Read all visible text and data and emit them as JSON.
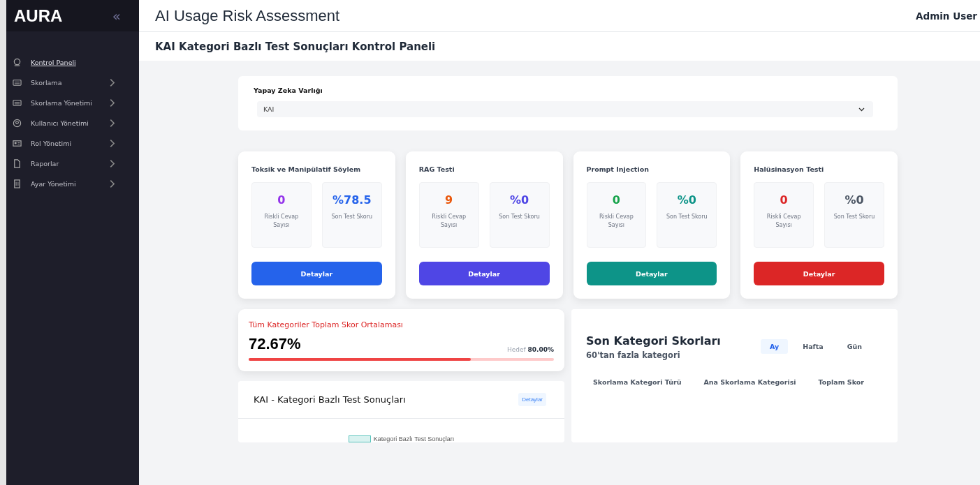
{
  "sidebar": {
    "logo": "AURA",
    "collapse_glyph": "«",
    "items": [
      {
        "label": "Kontrol Paneli",
        "selected": true,
        "has_submenu": false
      },
      {
        "label": "Skorlama",
        "selected": false,
        "has_submenu": true
      },
      {
        "label": "Skorlama Yönetimi",
        "selected": false,
        "has_submenu": true
      },
      {
        "label": "Kullanıcı Yönetimi",
        "selected": false,
        "has_submenu": true
      },
      {
        "label": "Rol Yönetimi",
        "selected": false,
        "has_submenu": true
      },
      {
        "label": "Raporlar",
        "selected": false,
        "has_submenu": true
      },
      {
        "label": "Ayar Yönetimi",
        "selected": false,
        "has_submenu": true
      }
    ]
  },
  "header": {
    "title": "AI Usage Risk Assessment",
    "user": "Admin User"
  },
  "page_title": "KAI Kategori Bazlı Test Sonuçları Kontrol Paneli",
  "entity_select": {
    "label": "Yapay Zeka Varlığı",
    "value": "KAI"
  },
  "test_cards": [
    {
      "title": "Toksik ve Manipülatif Söylem",
      "button": "Detaylar",
      "color": "#2563eb",
      "stats": [
        {
          "value": "0",
          "label": "Riskli Cevap Sayısı",
          "color": "#9333ea"
        },
        {
          "value": "%78.5",
          "label": "Son Test Skoru",
          "color": "#2563eb"
        }
      ]
    },
    {
      "title": "RAG Testi",
      "button": "Detaylar",
      "color": "#4f46e5",
      "stats": [
        {
          "value": "9",
          "label": "Riskli Cevap Sayısı",
          "color": "#ea580c"
        },
        {
          "value": "%0",
          "label": "Son Test Skoru",
          "color": "#4f46e5"
        }
      ]
    },
    {
      "title": "Prompt Injection",
      "button": "Detaylar",
      "color": "#0d9488",
      "stats": [
        {
          "value": "0",
          "label": "Riskli Cevap Sayısı",
          "color": "#16a34a"
        },
        {
          "value": "%0",
          "label": "Son Test Skoru",
          "color": "#0d9488"
        }
      ]
    },
    {
      "title": "Halüsinasyon Testi",
      "button": "Detaylar",
      "color": "#dc2626",
      "stats": [
        {
          "value": "0",
          "label": "Riskli Cevap Sayısı",
          "color": "#dc2626"
        },
        {
          "value": "%0",
          "label": "Son Test Skoru",
          "color": "#4b5563"
        }
      ]
    }
  ],
  "average": {
    "title": "Tüm Kategoriler Toplam Skor Ortalaması",
    "value": "72.67%",
    "target": "Hedef **80.00%**",
    "level": 0.7267
  },
  "category_results": {
    "title": "KAI - Kategori Bazlı Test Sonuçları",
    "button": "Detaylar",
    "legend": "Kategori Bazlı Test Sonuçları"
  },
  "recent_scores": {
    "title": "Son Kategori Skorları",
    "subtitle": "60'tan fazla kategori",
    "tabs": [
      {
        "label": "Ay",
        "selected": true
      },
      {
        "label": "Hafta",
        "selected": false
      },
      {
        "label": "Gün",
        "selected": false
      }
    ],
    "columns": [
      "Skorlama Kategori Türü",
      "Ana Skorlama Kategorisi",
      "Toplam Skor"
    ]
  }
}
